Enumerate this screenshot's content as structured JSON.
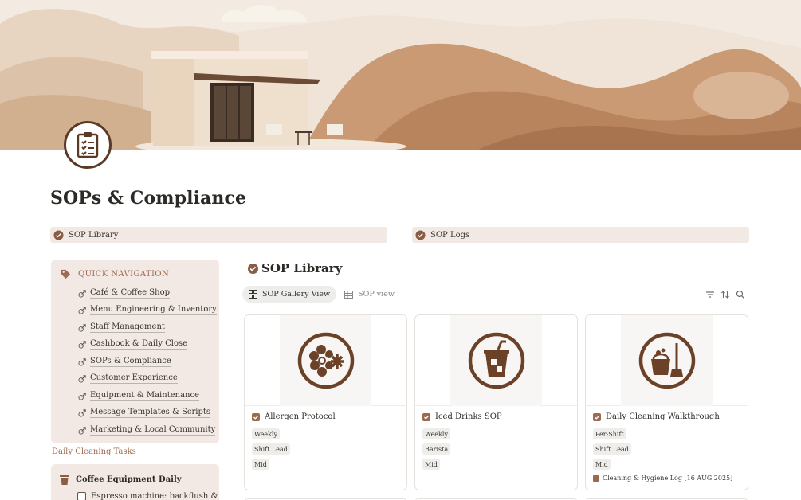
{
  "page": {
    "title": "SOPs & Compliance",
    "icon": "clipboard-checklist-icon"
  },
  "linked_pages": [
    {
      "label": "SOP Library",
      "icon": "badge-check-icon"
    },
    {
      "label": "SOP Logs",
      "icon": "badge-check-icon"
    }
  ],
  "quick_nav": {
    "heading": "QUICK NAVIGATION",
    "heading_icon": "tag-icon",
    "items": [
      {
        "label": "Café & Coffee Shop"
      },
      {
        "label": "Menu Engineering & Inventory"
      },
      {
        "label": "Staff Management"
      },
      {
        "label": "Cashbook & Daily Close"
      },
      {
        "label": "SOPs & Compliance"
      },
      {
        "label": "Customer Experience"
      },
      {
        "label": "Equipment & Maintenance"
      },
      {
        "label": "Message Templates & Scripts"
      },
      {
        "label": "Marketing & Local Community"
      }
    ]
  },
  "daily_cleaning": {
    "heading": "Daily Cleaning Tasks",
    "box_title": "Coffee Equipment Daily",
    "task": "Espresso machine: backflush &"
  },
  "library": {
    "title": "SOP Library",
    "views": [
      {
        "label": "SOP Gallery View",
        "active": true
      },
      {
        "label": "SOP view",
        "active": false
      }
    ],
    "cards": [
      {
        "name": "Allergen Protocol",
        "icon": "allergen-flower-icon",
        "tags": [
          "Weekly",
          "Shift Lead",
          "Mid"
        ],
        "relation": ""
      },
      {
        "name": "Iced Drinks SOP",
        "icon": "iced-drink-icon",
        "tags": [
          "Weekly",
          "Barista",
          "Mid"
        ],
        "relation": ""
      },
      {
        "name": "Daily Cleaning Walkthrough",
        "icon": "cleaning-bucket-mop-icon",
        "tags": [
          "Per-Shift",
          "Shift Lead",
          "Mid"
        ],
        "relation": "Cleaning & Hygiene Log [16 AUG 2025]"
      }
    ]
  },
  "colors": {
    "accent": "#9a6a51",
    "icon_brown": "#6b4128",
    "callout_bg": "#f3e9e4",
    "heading_brown": "#9f6b53"
  }
}
